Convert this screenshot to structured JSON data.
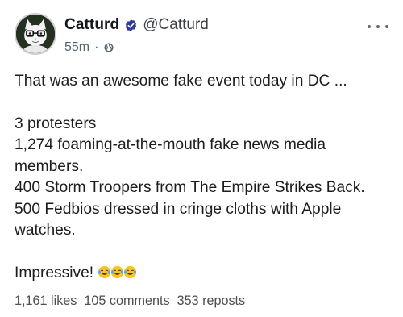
{
  "post": {
    "author": {
      "display_name": "Catturd",
      "handle": "@Catturd",
      "verified": true,
      "verified_color": "#1d9bf0"
    },
    "meta": {
      "age": "55m",
      "separator": "·",
      "visibility_icon": "globe-icon"
    },
    "more_icon": "ellipsis-icon",
    "body": {
      "line1": "That was an awesome fake event today in DC ...",
      "line2": "3 protesters",
      "line3": "1,274 foaming-at-the-mouth fake news media members.",
      "line4": "400 Storm Troopers from The Empire Strikes Back.",
      "line5": "500 Fedbios dressed in cringe cloths with Apple watches.",
      "line6": "Impressive!",
      "emoji": "tears-of-joy-emoji"
    },
    "stats": {
      "likes": "1,161 likes",
      "comments": "105 comments",
      "reposts": "353 reposts"
    }
  }
}
